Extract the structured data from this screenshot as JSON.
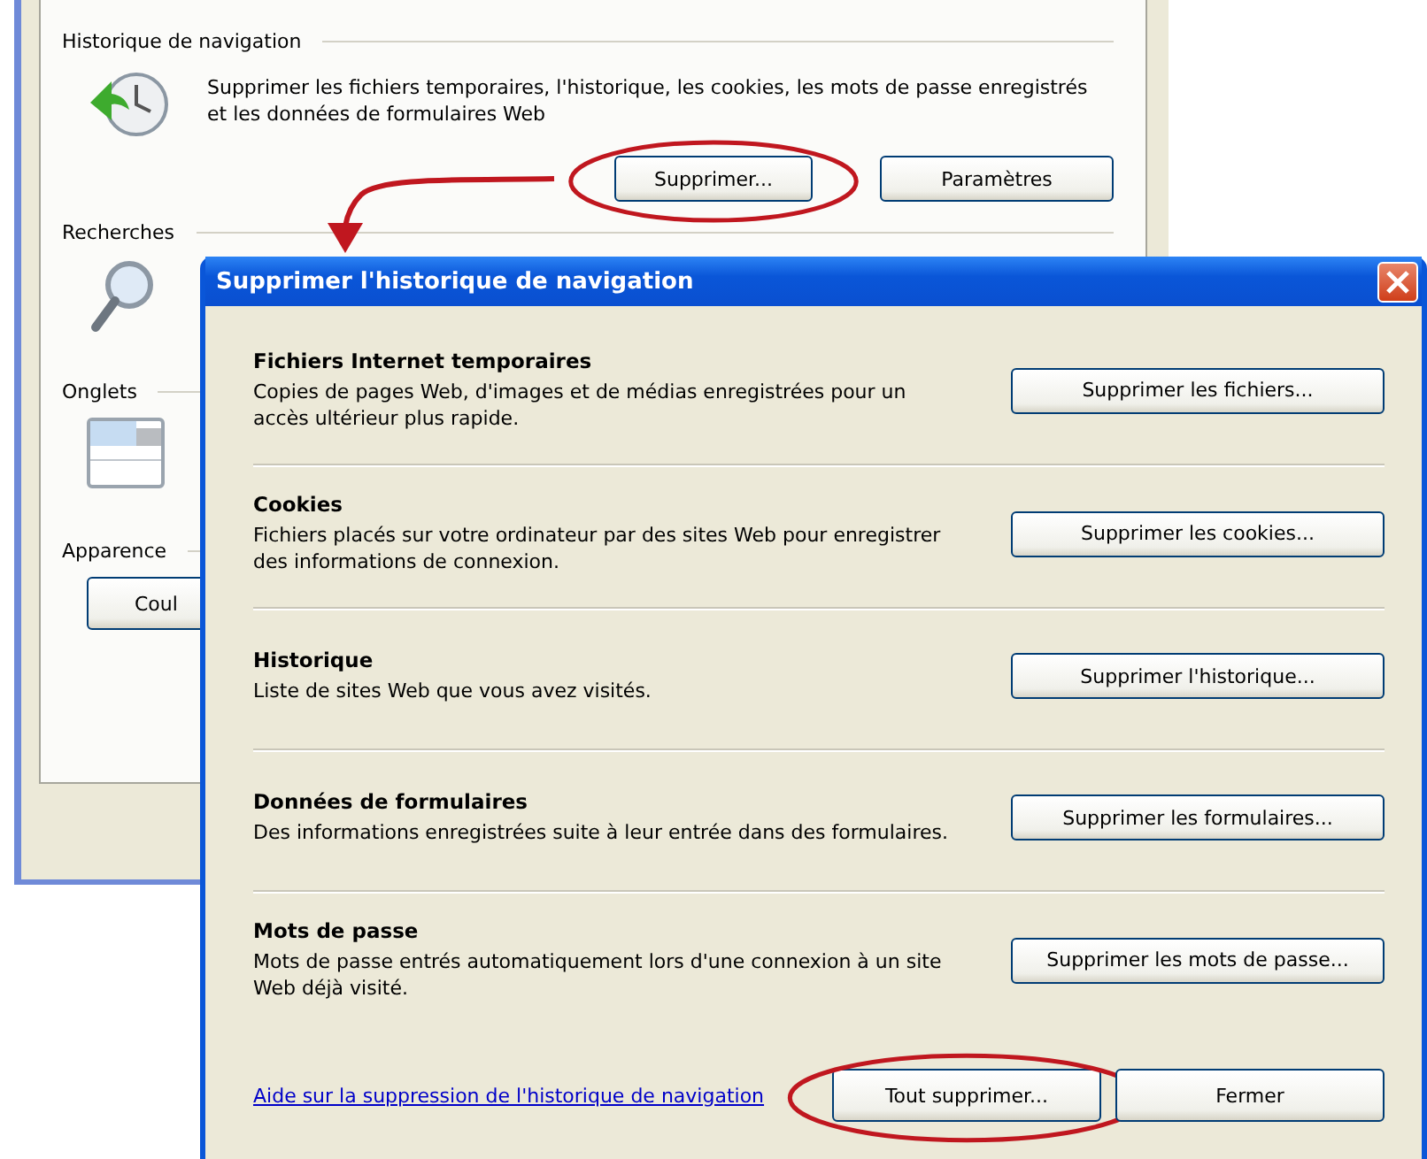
{
  "background_window": {
    "sections": [
      {
        "title": "Historique de navigation",
        "description": "Supprimer les fichiers temporaires, l'historique, les cookies, les mots de passe enregistrés et les données de formulaires Web",
        "buttons": [
          {
            "label": "Supprimer...",
            "circled": true
          },
          {
            "label": "Paramètres",
            "circled": false
          }
        ]
      },
      {
        "title": "Recherches"
      },
      {
        "title": "Onglets"
      },
      {
        "title": "Apparence",
        "buttons": [
          {
            "label": "Coul",
            "circled": false
          }
        ]
      }
    ]
  },
  "dialog": {
    "title": "Supprimer l'historique de navigation",
    "sections": [
      {
        "title": "Fichiers Internet temporaires",
        "description": "Copies de pages Web, d'images et de médias enregistrées pour un accès ultérieur plus rapide.",
        "button": "Supprimer les fichiers..."
      },
      {
        "title": "Cookies",
        "description": "Fichiers placés sur votre ordinateur par des sites Web pour enregistrer des informations de connexion.",
        "button": "Supprimer les cookies..."
      },
      {
        "title": "Historique",
        "description": "Liste de sites Web que vous avez visités.",
        "button": "Supprimer l'historique..."
      },
      {
        "title": "Données de formulaires",
        "description": "Des informations enregistrées suite à leur entrée dans des formulaires.",
        "button": "Supprimer les formulaires..."
      },
      {
        "title": "Mots de passe",
        "description": "Mots de passe entrés automatiquement lors d'une connexion à un site Web déjà visité.",
        "button": "Supprimer les mots de passe..."
      }
    ],
    "help_link": "Aide sur la suppression de l'historique de navigation",
    "buttons": [
      {
        "label": "Tout supprimer...",
        "circled": true
      },
      {
        "label": "Fermer",
        "circled": false
      }
    ]
  }
}
